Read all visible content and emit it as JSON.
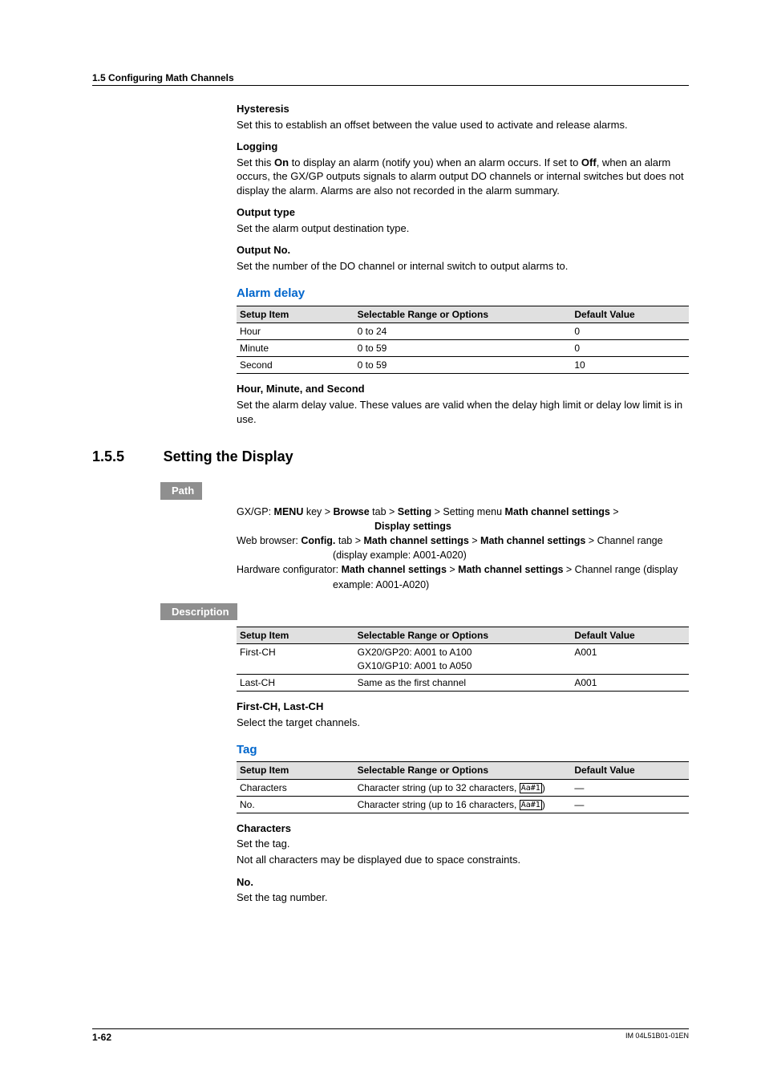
{
  "running_head": "1.5  Configuring Math Channels",
  "sections": {
    "hysteresis": {
      "title": "Hysteresis",
      "body": "Set this to establish an offset between the value used to activate and release alarms."
    },
    "logging": {
      "title": "Logging",
      "body_pre": "Set this ",
      "b1": "On",
      "body_mid": " to display an alarm (notify you) when an alarm occurs. If set to ",
      "b2": "Off",
      "body_post": ", when an alarm occurs, the GX/GP outputs signals to alarm output DO channels or internal switches but does not display the alarm. Alarms are also not recorded in the alarm summary."
    },
    "output_type": {
      "title": "Output type",
      "body": "Set the alarm output destination type."
    },
    "output_no": {
      "title": "Output No.",
      "body": "Set the number of the DO channel or internal switch to output alarms to."
    }
  },
  "alarm_delay": {
    "title": "Alarm delay",
    "headers": [
      "Setup Item",
      "Selectable Range or Options",
      "Default Value"
    ],
    "rows": [
      {
        "a": "Hour",
        "b": "0 to 24",
        "c": "0"
      },
      {
        "a": "Minute",
        "b": "0 to 59",
        "c": "0"
      },
      {
        "a": "Second",
        "b": "0 to 59",
        "c": "10"
      }
    ],
    "sub_title": "Hour, Minute, and Second",
    "sub_body": "Set the alarm delay value. These values are valid when the delay high limit or delay low limit is in use."
  },
  "setting_display": {
    "num": "1.5.5",
    "title": "Setting the Display",
    "path_label": "Path",
    "path1_a": "GX/GP: ",
    "path1_b": "MENU",
    "path1_c": " key > ",
    "path1_d": "Browse",
    "path1_e": " tab > ",
    "path1_f": "Setting",
    "path1_g": " > Setting menu ",
    "path1_h": "Math channel settings",
    "path1_i": " > ",
    "path1_j": "Display settings",
    "path2_a": "Web browser: ",
    "path2_b": "Config.",
    "path2_c": " tab > ",
    "path2_d": "Math channel settings",
    "path2_e": " > ",
    "path2_f": "Math channel settings",
    "path2_g": " > Channel range (display example: A001-A020)",
    "path3_a": "Hardware configurator: ",
    "path3_b": "Math channel settings",
    "path3_c": " > ",
    "path3_d": "Math channel settings",
    "path3_e": " > Channel range (display example: A001-A020)",
    "desc_label": "Description",
    "headers": [
      "Setup Item",
      "Selectable Range or Options",
      "Default Value"
    ],
    "rows": [
      {
        "a": "First-CH",
        "b": "GX20/GP20: A001 to A100\nGX10/GP10: A001 to A050",
        "c": "A001"
      },
      {
        "a": "Last-CH",
        "b": "Same as the first channel",
        "c": "A001"
      }
    ],
    "firstlast_title": "First-CH, Last-CH",
    "firstlast_body": "Select the target channels."
  },
  "tag": {
    "title": "Tag",
    "headers": [
      "Setup Item",
      "Selectable Range or Options",
      "Default Value"
    ],
    "rows": [
      {
        "a": "Characters",
        "b1": "Character string (up to 32 characters, ",
        "key": "Aa#1",
        "b2": ")",
        "c": "—"
      },
      {
        "a": "No.",
        "b1": "Character string (up to 16 characters, ",
        "key": "Aa#1",
        "b2": ")",
        "c": "—"
      }
    ],
    "characters_title": "Characters",
    "characters_body1": "Set the tag.",
    "characters_body2": "Not all characters may be displayed due to space constraints.",
    "no_title": "No.",
    "no_body": "Set the tag number."
  },
  "footer": {
    "page": "1-62",
    "doc": "IM 04L51B01-01EN"
  }
}
